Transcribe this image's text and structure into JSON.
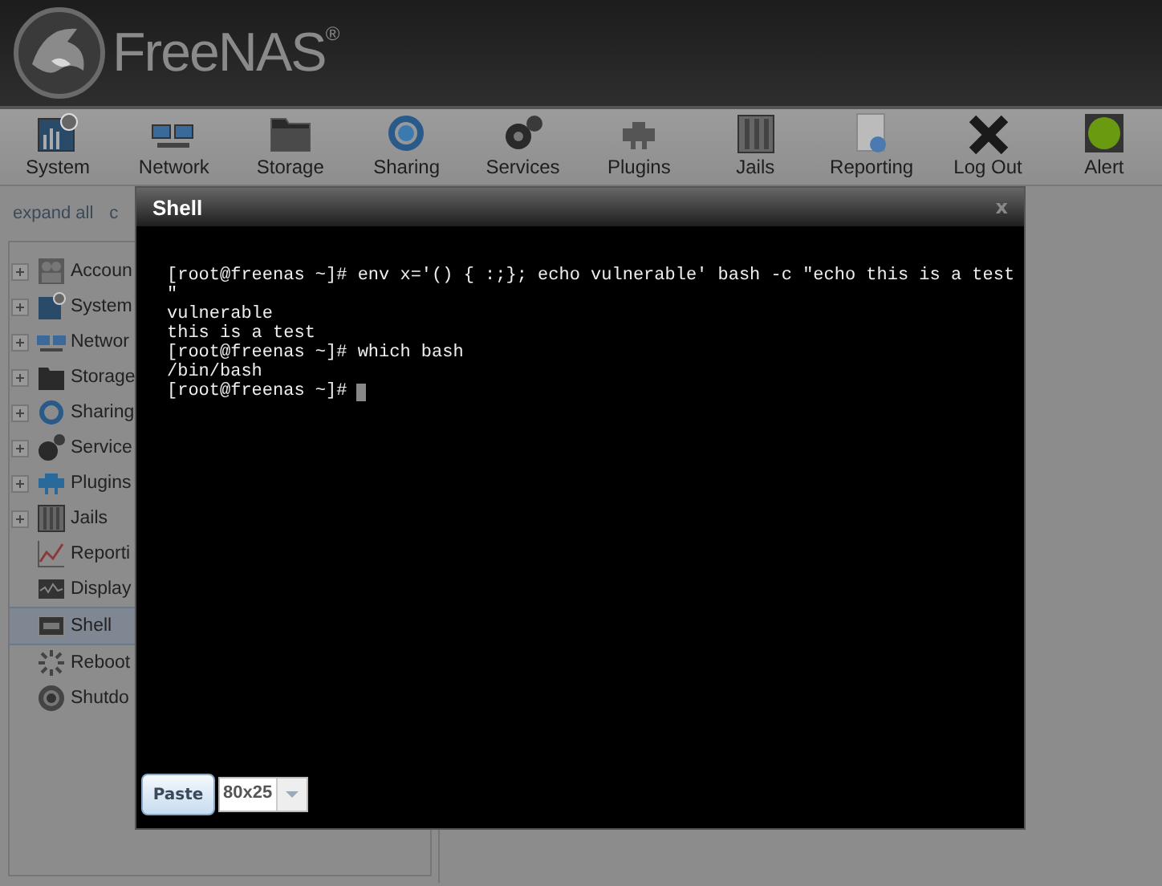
{
  "header": {
    "brand": "FreeNAS",
    "registered": "®"
  },
  "toolbar": [
    {
      "label": "System"
    },
    {
      "label": "Network"
    },
    {
      "label": "Storage"
    },
    {
      "label": "Sharing"
    },
    {
      "label": "Services"
    },
    {
      "label": "Plugins"
    },
    {
      "label": "Jails"
    },
    {
      "label": "Reporting"
    },
    {
      "label": "Log Out"
    },
    {
      "label": "Alert"
    }
  ],
  "tree_controls": [
    "expand all",
    "c"
  ],
  "sidebar": {
    "items": [
      {
        "label": "Accoun",
        "expandable": true,
        "selected": false
      },
      {
        "label": "System",
        "expandable": true,
        "selected": false
      },
      {
        "label": "Networ",
        "expandable": true,
        "selected": false
      },
      {
        "label": "Storage",
        "expandable": true,
        "selected": false
      },
      {
        "label": "Sharing",
        "expandable": true,
        "selected": false
      },
      {
        "label": "Service",
        "expandable": true,
        "selected": false
      },
      {
        "label": "Plugins",
        "expandable": true,
        "selected": false
      },
      {
        "label": "Jails",
        "expandable": true,
        "selected": false
      },
      {
        "label": "Reporti",
        "expandable": false,
        "selected": false
      },
      {
        "label": "Display",
        "expandable": false,
        "selected": false
      },
      {
        "label": "Shell",
        "expandable": false,
        "selected": true
      },
      {
        "label": "Reboot",
        "expandable": false,
        "selected": false
      },
      {
        "label": "Shutdo",
        "expandable": false,
        "selected": false
      }
    ]
  },
  "dialog": {
    "title": "Shell",
    "close": "x",
    "terminal_lines": [
      "[root@freenas ~]# env x='() { :;}; echo vulnerable' bash -c \"echo this is a test",
      "\"",
      "vulnerable",
      "this is a test",
      "[root@freenas ~]# which bash",
      "/bin/bash",
      "[root@freenas ~]#"
    ],
    "paste_button": "Paste",
    "size_select": {
      "value": "80x25"
    }
  }
}
